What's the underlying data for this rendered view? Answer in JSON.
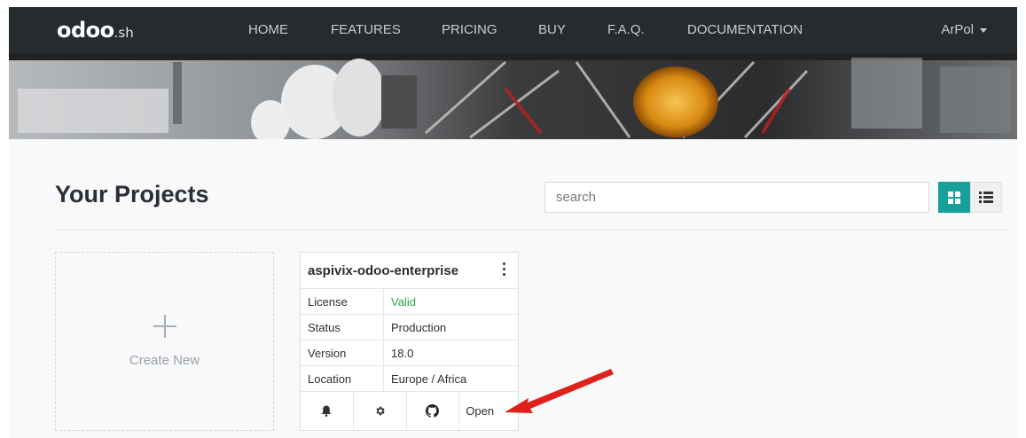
{
  "nav": {
    "logo_main": "odoo",
    "logo_suffix": ".sh",
    "links": [
      "HOME",
      "FEATURES",
      "PRICING",
      "BUY",
      "F.A.Q.",
      "DOCUMENTATION"
    ],
    "user": "ArPol"
  },
  "page": {
    "title": "Your Projects",
    "search_placeholder": "search"
  },
  "create_new": {
    "label": "Create New"
  },
  "project": {
    "name": "aspivix-odoo-enterprise",
    "rows": [
      {
        "key": "License",
        "value": "Valid"
      },
      {
        "key": "Status",
        "value": "Production"
      },
      {
        "key": "Version",
        "value": "18.0"
      },
      {
        "key": "Location",
        "value": "Europe / Africa"
      }
    ],
    "open_label": "Open",
    "valid_color": "#28a745"
  },
  "colors": {
    "navbar": "#262b2f",
    "accent": "#17a09a",
    "annotation_arrow": "#e0201c"
  },
  "icons": [
    "bell-icon",
    "gear-icon",
    "github-icon",
    "grid-icon",
    "list-icon",
    "kebab-icon",
    "plus-icon"
  ]
}
